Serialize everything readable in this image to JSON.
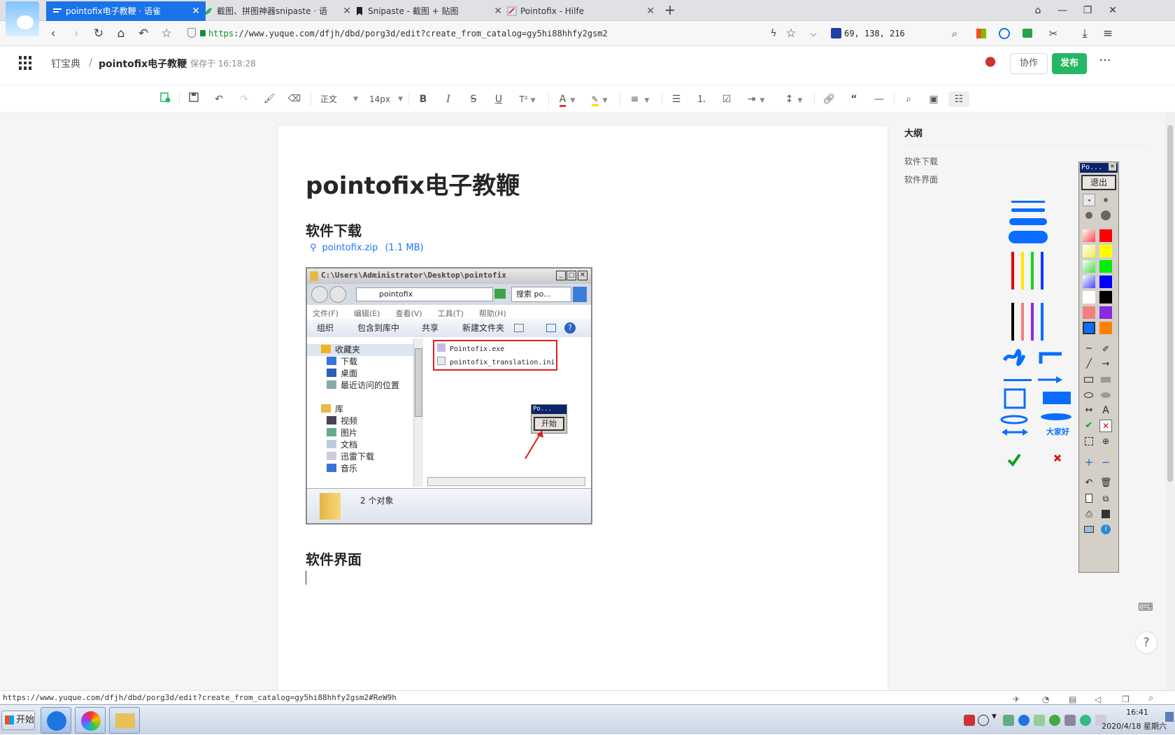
{
  "browser": {
    "tabs": [
      {
        "title": "pointofix电子教鞭 · 语雀",
        "active": true
      },
      {
        "title": "截图、拼图神器snipaste · 语",
        "active": false
      },
      {
        "title": "Snipaste - 截图 + 贴图",
        "active": false
      },
      {
        "title": "Pointofix - Hilfe",
        "active": false
      }
    ],
    "new_tab_label": "+",
    "url_scheme": "https",
    "url_rest": "://www.yuque.com/dfjh/dbd/porg3d/edit?create_from_catalog=gy5hi88hhfy2gsm2",
    "color_readout": "69, 138, 216"
  },
  "app": {
    "breadcrumb_book": "钉宝典",
    "breadcrumb_sep": "/",
    "doc_name": "pointofix电子教鞭",
    "save_status": "保存于 16:18:28",
    "collab_label": "协作",
    "publish_label": "发布",
    "more_label": "···"
  },
  "toolbar": {
    "paragraph_style": "正文",
    "font_size": "14px"
  },
  "doc": {
    "title": "pointofix电子教鞭",
    "section1_heading": "软件下载",
    "attachment_name": "pointofix.zip",
    "attachment_size": "(1.1 MB)",
    "section2_heading": "软件界面"
  },
  "explorer": {
    "title_path": "C:\\Users\\Administrator\\Desktop\\pointofix",
    "address": "pointofix",
    "search_placeholder": "搜索 po...",
    "menu": [
      "文件(F)",
      "编辑(E)",
      "查看(V)",
      "工具(T)",
      "帮助(H)"
    ],
    "commands": [
      "组织",
      "包含到库中",
      "共享",
      "新建文件夹"
    ],
    "tree": [
      "收藏夹",
      "下载",
      "桌面",
      "最近访问的位置",
      "库",
      "视频",
      "图片",
      "文档",
      "迅雷下载",
      "音乐"
    ],
    "files": [
      "Pointofix.exe",
      "pointofix_translation.ini"
    ],
    "mini_window_title": "Po...",
    "mini_window_button": "开始",
    "status_count": "2 个对象"
  },
  "outline": {
    "title": "大纲",
    "items": [
      "软件下载",
      "软件界面"
    ]
  },
  "pointofix_toolbar": {
    "title": "Po...",
    "exit_label": "退出",
    "preview_text_label": "大家好"
  },
  "status_bar_url": "https://www.yuque.com/dfjh/dbd/porg3d/edit?create_from_catalog=gy5hi88hhfy2gsm2#ReW9h",
  "taskbar": {
    "start_label": "开始",
    "clock_time": "16:41",
    "clock_date": "2020/4/18 星期六"
  },
  "colors": {
    "accent_blue": "#1a73e8",
    "publish_green": "#25b864",
    "link_blue": "#1677ff"
  }
}
